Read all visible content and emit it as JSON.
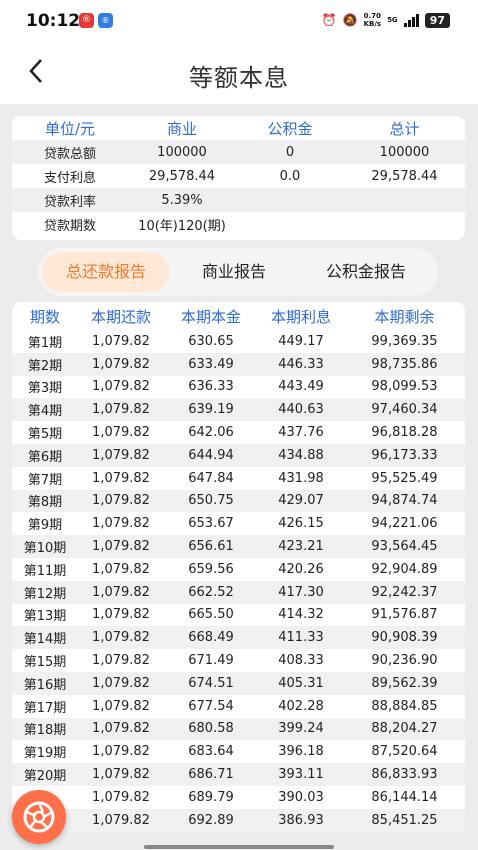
{
  "status_bar": {
    "time": "10:12",
    "app1": "®",
    "app2": "®",
    "net_speed_value": "0.70",
    "net_speed_unit": "KB/s",
    "network": "5G",
    "battery": "97"
  },
  "header": {
    "back_icon": "chevron-left-icon",
    "title": "等额本息"
  },
  "summary": {
    "headers": [
      "单位/元",
      "商业",
      "公积金",
      "总计"
    ],
    "rows": [
      [
        "贷款总额",
        "100000",
        "0",
        "100000"
      ],
      [
        "支付利息",
        "29,578.44",
        "0.0",
        "29,578.44"
      ],
      [
        "贷款利率",
        "5.39%",
        "",
        ""
      ],
      [
        "贷款期数",
        "10(年)120(期)",
        "",
        ""
      ]
    ]
  },
  "tabs": [
    {
      "label": "总还款报告",
      "active": true
    },
    {
      "label": "商业报告",
      "active": false
    },
    {
      "label": "公积金报告",
      "active": false
    }
  ],
  "schedule": {
    "headers": [
      "期数",
      "本期还款",
      "本期本金",
      "本期利息",
      "本期剩余"
    ],
    "rows": [
      [
        "第1期",
        "1,079.82",
        "630.65",
        "449.17",
        "99,369.35"
      ],
      [
        "第2期",
        "1,079.82",
        "633.49",
        "446.33",
        "98,735.86"
      ],
      [
        "第3期",
        "1,079.82",
        "636.33",
        "443.49",
        "98,099.53"
      ],
      [
        "第4期",
        "1,079.82",
        "639.19",
        "440.63",
        "97,460.34"
      ],
      [
        "第5期",
        "1,079.82",
        "642.06",
        "437.76",
        "96,818.28"
      ],
      [
        "第6期",
        "1,079.82",
        "644.94",
        "434.88",
        "96,173.33"
      ],
      [
        "第7期",
        "1,079.82",
        "647.84",
        "431.98",
        "95,525.49"
      ],
      [
        "第8期",
        "1,079.82",
        "650.75",
        "429.07",
        "94,874.74"
      ],
      [
        "第9期",
        "1,079.82",
        "653.67",
        "426.15",
        "94,221.06"
      ],
      [
        "第10期",
        "1,079.82",
        "656.61",
        "423.21",
        "93,564.45"
      ],
      [
        "第11期",
        "1,079.82",
        "659.56",
        "420.26",
        "92,904.89"
      ],
      [
        "第12期",
        "1,079.82",
        "662.52",
        "417.30",
        "92,242.37"
      ],
      [
        "第13期",
        "1,079.82",
        "665.50",
        "414.32",
        "91,576.87"
      ],
      [
        "第14期",
        "1,079.82",
        "668.49",
        "411.33",
        "90,908.39"
      ],
      [
        "第15期",
        "1,079.82",
        "671.49",
        "408.33",
        "90,236.90"
      ],
      [
        "第16期",
        "1,079.82",
        "674.51",
        "405.31",
        "89,562.39"
      ],
      [
        "第17期",
        "1,079.82",
        "677.54",
        "402.28",
        "88,884.85"
      ],
      [
        "第18期",
        "1,079.82",
        "680.58",
        "399.24",
        "88,204.27"
      ],
      [
        "第19期",
        "1,079.82",
        "683.64",
        "396.18",
        "87,520.64"
      ],
      [
        "第20期",
        "1,079.82",
        "686.71",
        "393.11",
        "86,833.93"
      ],
      [
        "",
        "1,079.82",
        "689.79",
        "390.03",
        "86,144.14"
      ],
      [
        "",
        "1,079.82",
        "692.89",
        "386.93",
        "85,451.25"
      ]
    ]
  },
  "fab": {
    "icon": "aperture-icon"
  },
  "colors": {
    "accent_blue": "#2f6bd6",
    "accent_orange": "#f07a2c",
    "tab_active_bg": "#ffe9d6",
    "fab": "#ff6f4a"
  }
}
